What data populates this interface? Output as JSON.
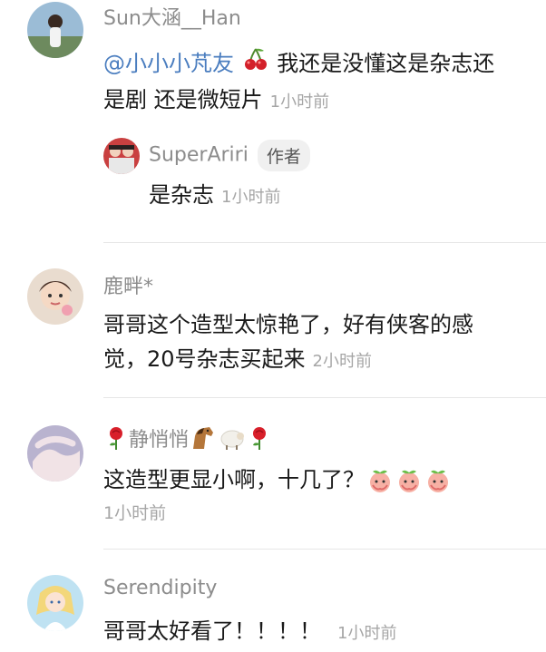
{
  "comments": [
    {
      "user": "Sun大涵__Han",
      "mention": "@小小小芃友",
      "text_line1_rest": " 我还是没懂这是杂志还",
      "text_line2": "是剧 还是微短片",
      "time": "1小时前",
      "reply": {
        "user": "SuperAriri",
        "badge": "作者",
        "text": "是杂志",
        "time": "1小时前"
      }
    },
    {
      "user": "鹿畔*",
      "text_line1": "哥哥这个造型太惊艳了，好有侠客的感",
      "text_line2": "觉，20号杂志买起来",
      "time": "2小时前"
    },
    {
      "user": "静悄悄",
      "text": "这造型更显小啊，十几了？",
      "time": "1小时前"
    },
    {
      "user": "Serendipity",
      "text": "哥哥太好看了！！！！",
      "time": "1小时前"
    }
  ],
  "icons": {
    "cherry": "cherry-icon",
    "rose": "rose-icon",
    "horse": "horse-icon",
    "sheep": "sheep-icon",
    "peach": "peach-emoji-icon"
  },
  "colors": {
    "mention": "#4a7dbf",
    "name": "#8c8c8c",
    "time": "#a6a6a6",
    "divider": "#e6e6e6"
  }
}
